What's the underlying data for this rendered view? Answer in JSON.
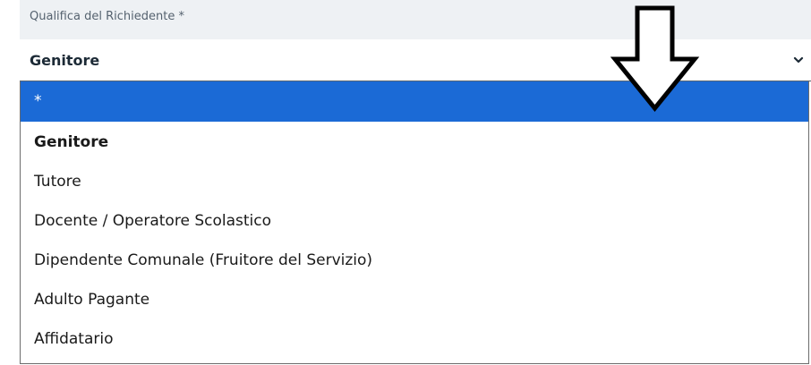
{
  "field": {
    "label": "Qualifica del Richiedente *",
    "selected_value": "Genitore",
    "chevron_icon": "chevron-down-icon"
  },
  "dropdown": {
    "highlight_color": "#1b6ad6",
    "options": [
      {
        "label": "*",
        "highlighted": true
      },
      {
        "label": "Genitore",
        "selected": true
      },
      {
        "label": "Tutore"
      },
      {
        "label": "Docente / Operatore Scolastico"
      },
      {
        "label": "Dipendente Comunale (Fruitore del Servizio)"
      },
      {
        "label": "Adulto Pagante"
      },
      {
        "label": "Affidatario"
      }
    ]
  },
  "annotation": {
    "icon": "down-arrow-icon"
  }
}
